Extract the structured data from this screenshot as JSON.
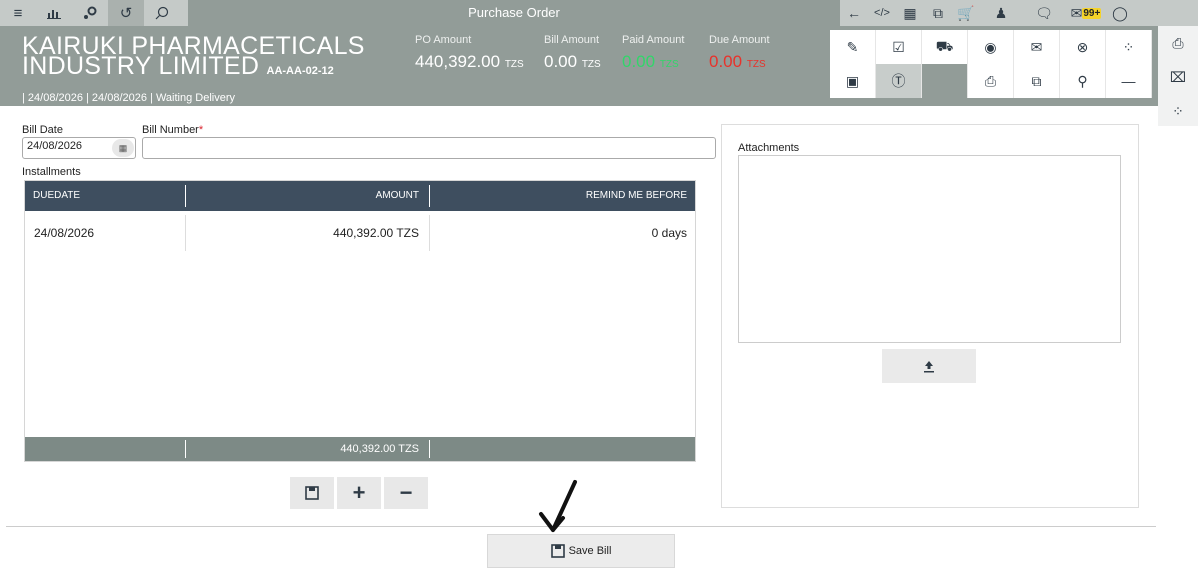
{
  "toolbar": {
    "title": "Purchase Order",
    "left_icons": [
      "menu-icon",
      "chart-icon",
      "workflow-icon",
      "history-icon",
      "search-icon"
    ],
    "right_icons": [
      "back-arrow-icon",
      "code-icon",
      "calculator-icon",
      "copy-icon",
      "cart-icon",
      "user-group-icon",
      "chat-icon",
      "mail-icon",
      "user-icon"
    ],
    "mail_badge": "99+"
  },
  "header": {
    "company_line1": "KAIRUKI PHARMACETICALS",
    "company_line2": "INDUSTRY LIMITED",
    "code": "AA-AA-02-12",
    "status_line": "| 24/08/2026 | 24/08/2026 | Waiting Delivery",
    "po_amount_label": "PO Amount",
    "po_amount_value": "440,392.00",
    "bill_amount_label": "Bill Amount",
    "bill_amount_value": "0.00",
    "paid_amount_label": "Paid Amount",
    "paid_amount_value": "0.00",
    "due_amount_label": "Due Amount",
    "due_amount_value": "0.00",
    "currency": "TZS"
  },
  "form": {
    "bill_date_label": "Bill Date",
    "bill_date_value": "24/08/2026",
    "bill_number_label": "Bill Number",
    "bill_number_required": "*",
    "bill_number_value": "",
    "installments_label": "Installments"
  },
  "table": {
    "headers": [
      "DUEDATE",
      "AMOUNT",
      "REMIND ME BEFORE"
    ],
    "rows": [
      {
        "duedate": "24/08/2026",
        "amount": "440,392.00 TZS",
        "remind": "0 days"
      }
    ],
    "total": "440,392.00 TZS"
  },
  "attachments": {
    "title": "Attachments"
  },
  "save_button": {
    "label": "Save Bill"
  }
}
